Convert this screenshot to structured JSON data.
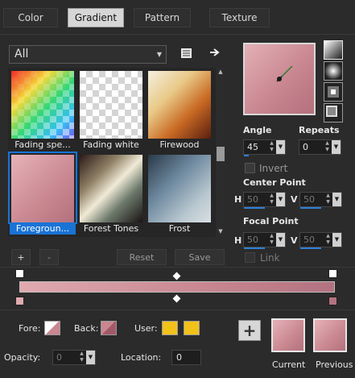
{
  "tabs": [
    {
      "label": "Color"
    },
    {
      "label": "Gradient"
    },
    {
      "label": "Pattern"
    },
    {
      "label": "Texture"
    }
  ],
  "filter": {
    "value": "All"
  },
  "gallery": [
    {
      "label": "Fading spe...",
      "selected": false
    },
    {
      "label": "Fading white",
      "selected": false
    },
    {
      "label": "Firewood",
      "selected": false
    },
    {
      "label": "Foregroun...",
      "selected": true
    },
    {
      "label": "Forest Tones",
      "selected": false
    },
    {
      "label": "Frost",
      "selected": false
    }
  ],
  "buttons": {
    "add": "+",
    "remove": "-",
    "reset": "Reset",
    "save": "Save"
  },
  "angle": {
    "label": "Angle",
    "value": "45",
    "fill": 0.12
  },
  "repeats": {
    "label": "Repeats",
    "value": "0"
  },
  "invert": {
    "label": "Invert",
    "checked": false
  },
  "center_point": {
    "label": "Center Point",
    "h_label": "H",
    "h_value": "50",
    "v_label": "V",
    "v_value": "50"
  },
  "focal_point": {
    "label": "Focal Point",
    "h_label": "H",
    "h_value": "50",
    "v_label": "V",
    "v_value": "50"
  },
  "link": {
    "label": "Link",
    "checked": false
  },
  "bottom": {
    "fore_label": "Fore:",
    "back_label": "Back:",
    "user_label": "User:",
    "opacity_label": "Opacity:",
    "opacity_value": "0",
    "location_label": "Location:",
    "location_value": "0",
    "add_symbol": "+",
    "current_label": "Current",
    "previous_label": "Previous"
  },
  "colors": {
    "accent": "#1a73d6",
    "gradient_start": "#e0aab0",
    "gradient_end": "#b37280",
    "user_swatch": "#f2c21b"
  },
  "icons": {
    "dropdown": "chevron-down-icon",
    "list_view": "list-icon",
    "apply": "arrow-right-icon",
    "type_linear": "linear-gradient-icon",
    "type_radial": "radial-gradient-icon",
    "type_rect": "rectangular-gradient-icon",
    "type_sunburst": "sunburst-gradient-icon"
  }
}
